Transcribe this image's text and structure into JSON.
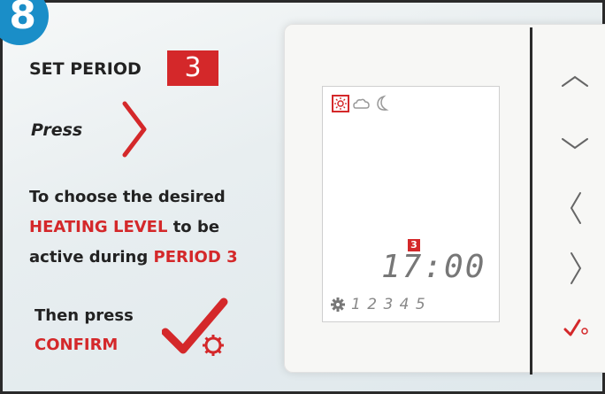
{
  "step": "8",
  "title": "SET PERIOD",
  "period_badge": "3",
  "press_label": "Press",
  "desc_line1": "To choose the desired",
  "desc_heating": "HEATING LEVEL",
  "desc_line2_rest": " to be",
  "desc_line3_prefix": "active during ",
  "desc_period": "PERIOD 3",
  "then_press": "Then press",
  "confirm_label": "CONFIRM",
  "display": {
    "period_indicator": "3",
    "time": "17:00",
    "periods": "1 2 3 4 5"
  },
  "colors": {
    "accent": "#d4282a",
    "step_badge": "#1a8ec8"
  },
  "icons": [
    "sun-icon",
    "cloud-sun-icon",
    "moon-icon",
    "settings-icon",
    "check-icon",
    "arrow-up-icon",
    "arrow-down-icon",
    "arrow-left-icon",
    "arrow-right-icon"
  ]
}
